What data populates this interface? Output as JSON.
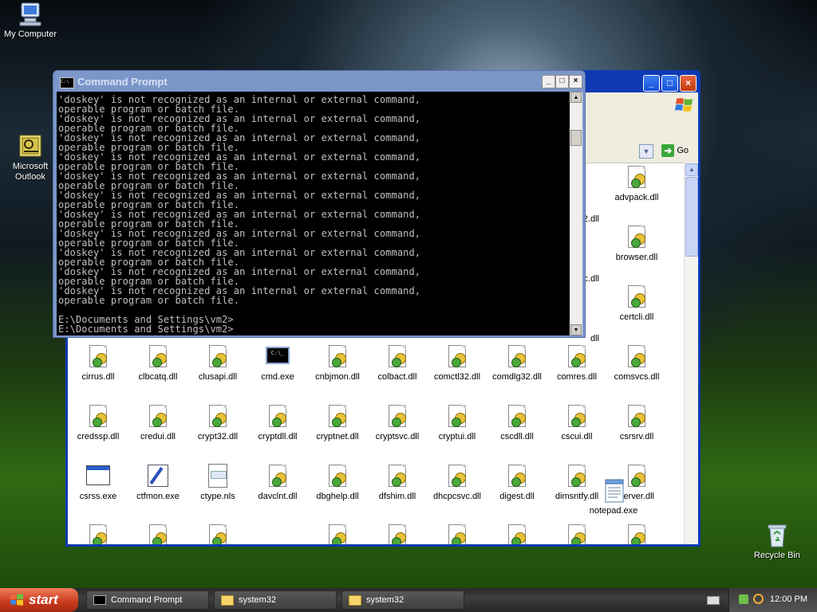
{
  "desktop": {
    "my_computer": "My Computer",
    "outlook_line1": "Microsoft",
    "outlook_line2": "Outlook",
    "recycle_bin": "Recycle Bin",
    "notepad": "notepad.exe"
  },
  "explorer": {
    "go_label": "Go",
    "files_partial_col9": [
      ".2.dll",
      ".c.dll",
      "dll"
    ],
    "files_col10": [
      "advpack.dll",
      "browser.dll",
      "certcli.dll"
    ],
    "row4": [
      "cirrus.dll",
      "clbcatq.dll",
      "clusapi.dll",
      "cmd.exe",
      "cnbjmon.dll",
      "colbact.dll",
      "comctl32.dll",
      "comdlg32.dll",
      "comres.dll",
      "comsvcs.dll"
    ],
    "row5": [
      "credssp.dll",
      "credui.dll",
      "crypt32.dll",
      "cryptdll.dll",
      "cryptnet.dll",
      "cryptsvc.dll",
      "cryptui.dll",
      "cscdll.dll",
      "cscui.dll",
      "csrsrv.dll"
    ],
    "row6": [
      "csrss.exe",
      "ctfmon.exe",
      "ctype.nls",
      "davclnt.dll",
      "dbghelp.dll",
      "dfshim.dll",
      "dhcpcsvc.dll",
      "digest.dll",
      "dimsntfy.dll",
      "server.dll"
    ]
  },
  "cmd": {
    "title": "Command Prompt",
    "icon_text": "C:\\",
    "output": "'doskey' is not recognized as an internal or external command,\noperable program or batch file.\n'doskey' is not recognized as an internal or external command,\noperable program or batch file.\n'doskey' is not recognized as an internal or external command,\noperable program or batch file.\n'doskey' is not recognized as an internal or external command,\noperable program or batch file.\n'doskey' is not recognized as an internal or external command,\noperable program or batch file.\n'doskey' is not recognized as an internal or external command,\noperable program or batch file.\n'doskey' is not recognized as an internal or external command,\noperable program or batch file.\n'doskey' is not recognized as an internal or external command,\noperable program or batch file.\n'doskey' is not recognized as an internal or external command,\noperable program or batch file.\n'doskey' is not recognized as an internal or external command,\noperable program or batch file.\n'doskey' is not recognized as an internal or external command,\noperable program or batch file.\n\nE:\\Documents and Settings\\vm2>\nE:\\Documents and Settings\\vm2>"
  },
  "taskbar": {
    "start_label": "start",
    "buttons": [
      "Command Prompt",
      "system32",
      "system32"
    ],
    "clock": "12:00 PM"
  },
  "colors": {
    "xp_blue": "#0d3ab3",
    "start_green": "#c8391c",
    "console_text": "#c0c0c0"
  }
}
